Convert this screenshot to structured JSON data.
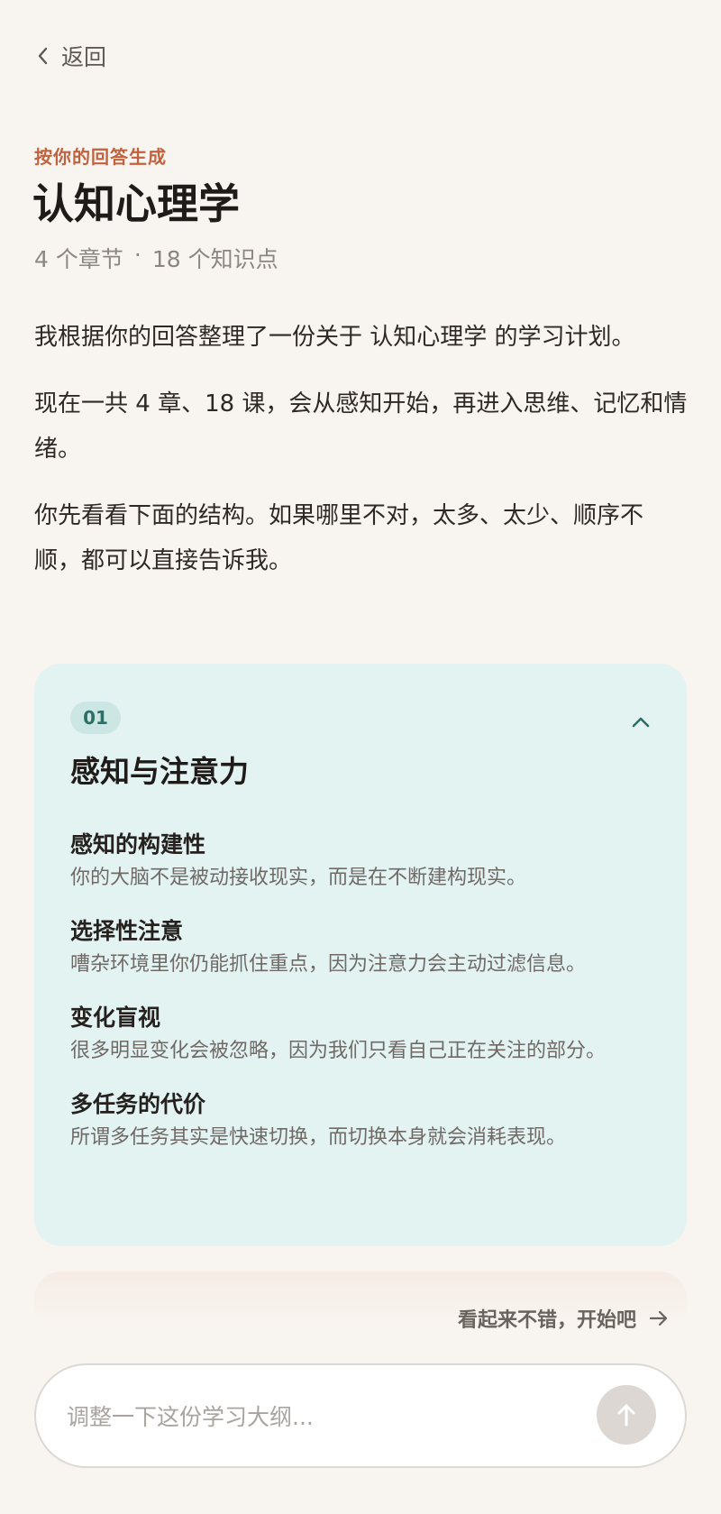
{
  "nav": {
    "back_label": "返回"
  },
  "header": {
    "eyebrow": "按你的回答生成",
    "title": "认知心理学",
    "meta_chapters": "4 个章节",
    "meta_separator": "·",
    "meta_points": "18 个知识点"
  },
  "intro": {
    "paragraphs": [
      "我根据你的回答整理了一份关于 认知心理学 的学习计划。",
      "现在一共 4 章、18 课，会从感知开始，再进入思维、记忆和情绪。",
      "你先看看下面的结构。如果哪里不对，太多、太少、顺序不顺，都可以直接告诉我。"
    ]
  },
  "chapter": {
    "number": "01",
    "title": "感知与注意力",
    "expanded": true,
    "icon": "chevron-up-icon",
    "topics": [
      {
        "title": "感知的构建性",
        "desc": "你的大脑不是被动接收现实，而是在不断建构现实。"
      },
      {
        "title": "选择性注意",
        "desc": "嘈杂环境里你仍能抓住重点，因为注意力会主动过滤信息。"
      },
      {
        "title": "变化盲视",
        "desc": "很多明显变化会被忽略，因为我们只看自己正在关注的部分。"
      },
      {
        "title": "多任务的代价",
        "desc": "所谓多任务其实是快速切换，而切换本身就会消耗表现。"
      }
    ]
  },
  "actions": {
    "start_label": "看起来不错，开始吧"
  },
  "composer": {
    "placeholder": "调整一下这份学习大纲...",
    "value": "",
    "send_icon": "arrow-up-icon"
  },
  "colors": {
    "background": "#f8f5f1",
    "accent": "#c2613d",
    "card": "#e3f3f2",
    "badge_text": "#2f6d67"
  }
}
